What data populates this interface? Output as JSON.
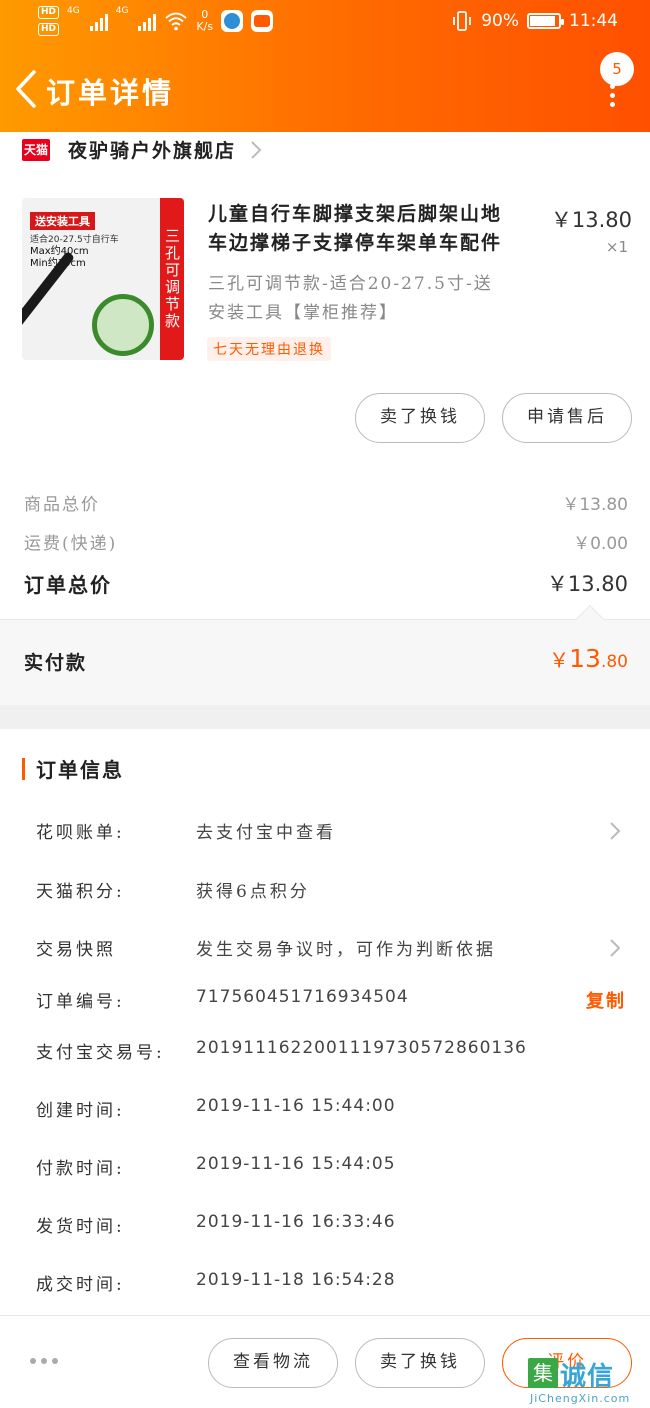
{
  "status_bar": {
    "hd1": "HD",
    "hd2": "HD",
    "net1": "4G",
    "net2": "4G",
    "speed_value": "0",
    "speed_unit": "K/s",
    "battery_text": "90%",
    "battery_level": 0.9,
    "time": "11:44"
  },
  "header": {
    "title": "订单详情",
    "notification_count": "5"
  },
  "shop": {
    "badge": "天猫",
    "name": "夜驴骑户外旗舰店"
  },
  "product": {
    "image_tag": "送安装工具",
    "image_side_text": "三孔可调节款",
    "image_line1": "适合20-27.5寸自行车",
    "image_line2": "Max约40cm",
    "image_line3": "Min约35cm",
    "title_line1": "儿童自行车脚撑支架后脚架山地",
    "title_line2": "车边撑梯子支撑停车架单车配件",
    "price": "￥13.80",
    "quantity": "×1",
    "sku_line1": "三孔可调节款-适合20-27.5寸-送",
    "sku_line2": "安装工具【掌柜推荐】",
    "tag": "七天无理由退换",
    "btn_resell": "卖了换钱",
    "btn_after_sale": "申请售后"
  },
  "prices": {
    "goods_label": "商品总价",
    "goods_value": "￥13.80",
    "shipping_label": "运费(快递)",
    "shipping_value": "￥0.00",
    "total_label": "订单总价",
    "total_value": "￥13.80",
    "paid_label": "实付款",
    "paid_currency": "￥",
    "paid_int": "13",
    "paid_dec": ".80"
  },
  "order_info": {
    "section_title": "订单信息",
    "rows": [
      {
        "key": "花呗账单:",
        "value": "去支付宝中查看"
      },
      {
        "key": "天猫积分:",
        "value": "获得6点积分"
      },
      {
        "key": "交易快照",
        "value": "发生交易争议时，可作为判断依据"
      },
      {
        "key": "订单编号:",
        "value": "717560451716934504"
      },
      {
        "key": "支付宝交易号:",
        "value": "2019111622001119730572860136"
      },
      {
        "key": "创建时间:",
        "value": "2019-11-16 15:44:00"
      },
      {
        "key": "付款时间:",
        "value": "2019-11-16 15:44:05"
      },
      {
        "key": "发货时间:",
        "value": "2019-11-16 16:33:46"
      },
      {
        "key": "成交时间:",
        "value": "2019-11-18 16:54:28"
      }
    ],
    "copy_label": "复制"
  },
  "bottom_bar": {
    "btn_logistics": "查看物流",
    "btn_resell": "卖了换钱",
    "btn_review": "评价"
  },
  "watermark": {
    "mark": "集",
    "text": "诚信",
    "url": "JiChengXin.com"
  },
  "colors": {
    "accent": "#ff5a00",
    "header_start": "#ff9a00",
    "header_end": "#ff5000",
    "tmall_red": "#e8001c"
  }
}
